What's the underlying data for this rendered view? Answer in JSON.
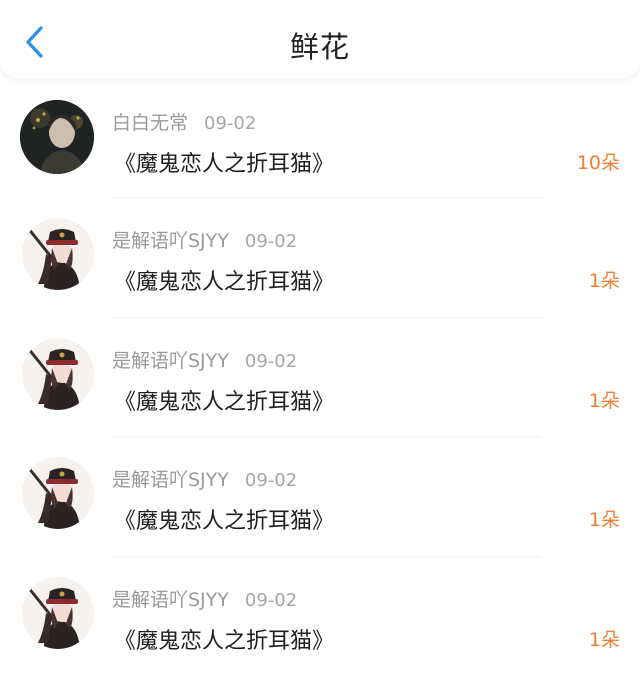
{
  "header": {
    "title": "鲜花",
    "back_icon": "chevron-left-icon",
    "accent_color": "#2f8ee8"
  },
  "items": [
    {
      "user": "白白无常",
      "date": "09-02",
      "book": "《魔鬼恋人之折耳猫》",
      "amount": "10朵",
      "avatar": "dark-portrait"
    },
    {
      "user": "是解语吖SJYY",
      "date": "09-02",
      "book": "《魔鬼恋人之折耳猫》",
      "amount": "1朵",
      "avatar": "anime-girl-cap"
    },
    {
      "user": "是解语吖SJYY",
      "date": "09-02",
      "book": "《魔鬼恋人之折耳猫》",
      "amount": "1朵",
      "avatar": "anime-girl-cap"
    },
    {
      "user": "是解语吖SJYY",
      "date": "09-02",
      "book": "《魔鬼恋人之折耳猫》",
      "amount": "1朵",
      "avatar": "anime-girl-cap"
    },
    {
      "user": "是解语吖SJYY",
      "date": "09-02",
      "book": "《魔鬼恋人之折耳猫》",
      "amount": "1朵",
      "avatar": "anime-girl-cap"
    }
  ],
  "colors": {
    "amount": "#f07f34",
    "meta": "#9a9a9a"
  }
}
